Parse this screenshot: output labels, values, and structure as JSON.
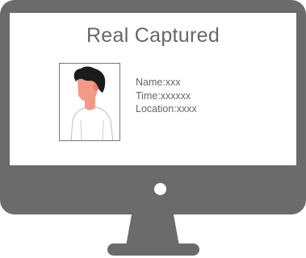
{
  "screen": {
    "title": "Real Captured",
    "info": {
      "name": "Name:xxx",
      "time": "Time:xxxxxx",
      "location": "Location:xxxx"
    }
  },
  "colors": {
    "monitor": "#6b6b6b",
    "screen": "#ffffff",
    "text": "#666666",
    "skin": "#f39985",
    "hair": "#1b1b1b"
  },
  "icons": {
    "avatar": "person-portrait-icon",
    "power": "power-indicator-icon"
  }
}
